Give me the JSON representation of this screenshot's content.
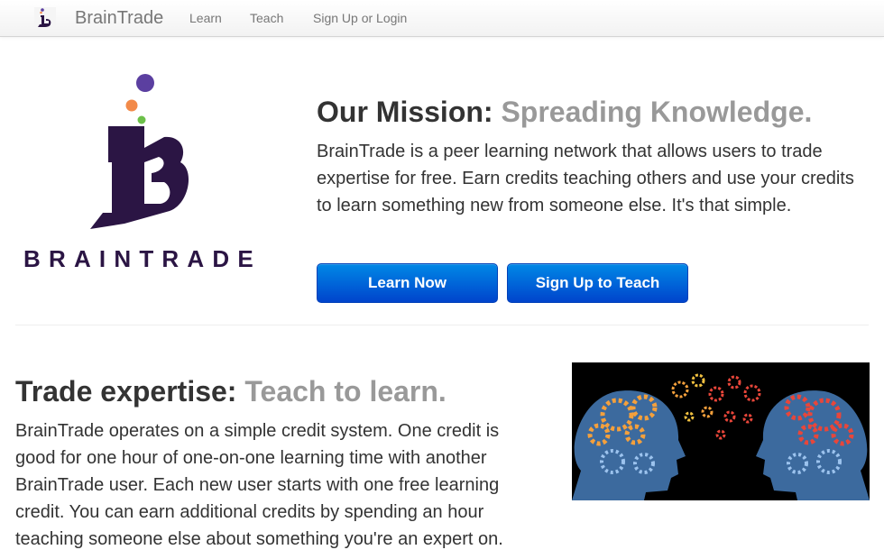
{
  "navbar": {
    "brand": "BrainTrade",
    "links": [
      "Learn",
      "Teach",
      "Sign Up or Login"
    ]
  },
  "hero": {
    "logo_wordmark": "BRAINTRADE",
    "title_strong": "Our Mission:",
    "title_muted": "Spreading Knowledge.",
    "body": "BrainTrade is a peer learning network that allows users to trade expertise for free. Earn credits teaching others and use your credits to learn something new from someone else. It's that simple.",
    "buttons": {
      "learn": "Learn Now",
      "teach": "Sign Up to Teach"
    }
  },
  "trade": {
    "title_strong": "Trade expertise:",
    "title_muted": "Teach to learn.",
    "body": "BrainTrade operates on a simple credit system. One credit is good for one hour of one-on-one learning time with another BrainTrade user. Each new user starts with one free learning credit. You can earn additional credits by spending an hour teaching someone else about something you're an expert on."
  },
  "colors": {
    "logo_purple": "#2b1544",
    "dot_purple": "#5b3fa0",
    "dot_orange": "#f28a4a",
    "dot_green": "#6cc04a",
    "button_blue": "#0066dd",
    "muted_text": "#999999"
  },
  "icons": {
    "brand": "braintrade-logo-icon",
    "hero_image": "gear-heads-image"
  }
}
